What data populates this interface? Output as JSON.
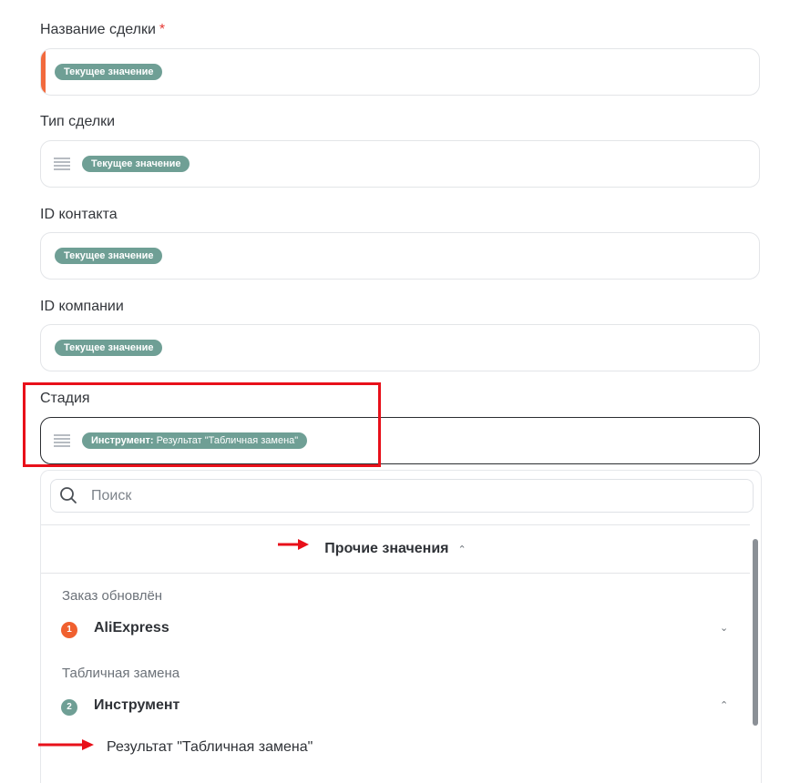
{
  "fields": [
    {
      "label": "Название сделки",
      "required_mark": "*",
      "pill": "Текущее значение"
    },
    {
      "label": "Тип сделки",
      "pill": "Текущее значение"
    },
    {
      "label": "ID контакта",
      "pill": "Текущее значение"
    },
    {
      "label": "ID компании",
      "pill": "Текущее значение"
    },
    {
      "label": "Стадия",
      "pill_bold": "Инструмент:",
      "pill_rest": " Результат \"Табличная замена\""
    }
  ],
  "dropdown": {
    "search_placeholder": "Поиск",
    "other_values_label": "Прочие значения",
    "groups": [
      {
        "title": "Заказ обновлён",
        "badge": "1",
        "item": "AliExpress"
      },
      {
        "title": "Табличная замена",
        "badge": "2",
        "item": "Инструмент",
        "subitem": "Результат \"Табличная замена\""
      }
    ]
  },
  "colors": {
    "pill": "#6f9f95",
    "accent_bar": "#f26a3d",
    "badge_1": "#f0602f",
    "badge_2": "#6f9f95",
    "highlight": "#e8101a",
    "annotation_arrow": "#e8101a"
  },
  "icons": [
    "list-icon",
    "search-icon",
    "chevron-up-icon",
    "chevron-down-icon",
    "arrow-right-icon"
  ]
}
